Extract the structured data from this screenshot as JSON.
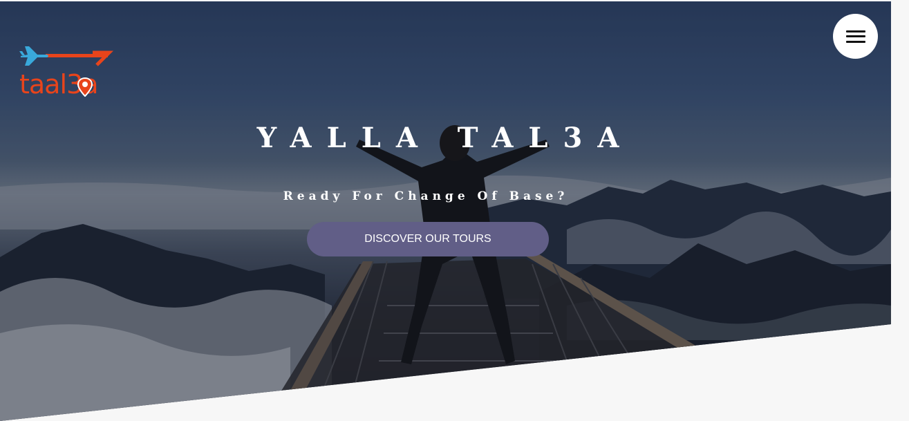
{
  "logo": {
    "text": "taal3a"
  },
  "header": {
    "menu_icon": "hamburger-menu-icon"
  },
  "hero": {
    "title": "YALLA TAL3A",
    "subtitle": "Ready For Change Of Base?",
    "cta_label": "DISCOVER OUR TOURS"
  },
  "colors": {
    "brand_orange": "#e8441b",
    "brand_blue": "#39a9db",
    "cta_bg": "#615e87",
    "page_bg": "#f7f7f7"
  }
}
